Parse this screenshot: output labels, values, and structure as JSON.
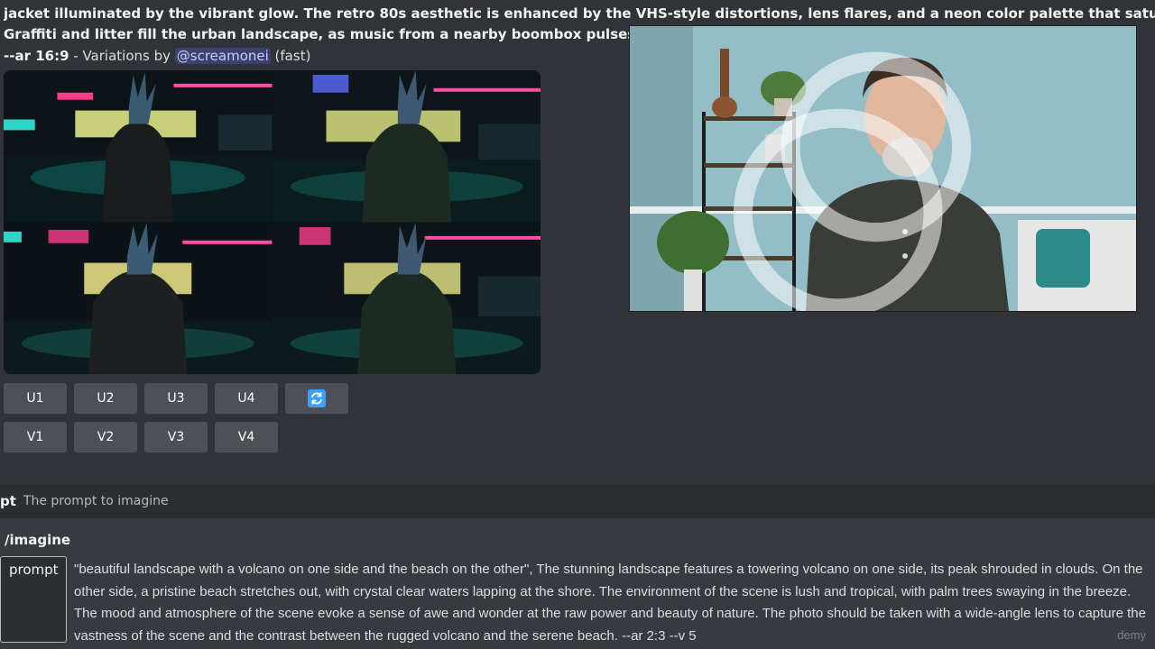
{
  "message": {
    "lines": [
      "jacket illuminated by the vibrant glow. The retro 80s aesthetic is enhanced by the VHS-style distortions, lens flares, and a neon color palette that saturates the scene.",
      "Graffiti and litter fill the urban landscape, as music from a nearby boombox pulses through"
    ],
    "aspect": "--ar 16:9",
    "variations_text": " - Variations by ",
    "mention": "@screamonei",
    "mode": " (fast)"
  },
  "buttons": {
    "upscale": [
      "U1",
      "U2",
      "U3",
      "U4"
    ],
    "variation": [
      "V1",
      "V2",
      "V3",
      "V4"
    ],
    "reroll_icon": "refresh-icon"
  },
  "option_hint": {
    "name": "pt",
    "description": "The prompt to imagine"
  },
  "command": {
    "name": "/imagine",
    "param_label": "prompt",
    "param_value": "\"beautiful landscape with a volcano on one side and the beach on the other\", The stunning landscape features a towering volcano on one side, its peak shrouded in clouds. On the other side, a pristine beach stretches out, with crystal clear waters lapping at the shore. The environment of the scene is lush and tropical, with palm trees swaying in the breeze. The mood and atmosphere of the scene evoke a sense of awe and wonder at the raw power and beauty of nature. The photo should be taken with a wide-angle lens to capture the vastness of the scene and the contrast between the rugged volcano and the serene beach. --ar 2:3 --v 5"
  },
  "watermark": "demy",
  "colors": {
    "background": "#313338",
    "button": "#4e5058",
    "accent": "#5865f2",
    "reroll": "#3ba0ff"
  }
}
